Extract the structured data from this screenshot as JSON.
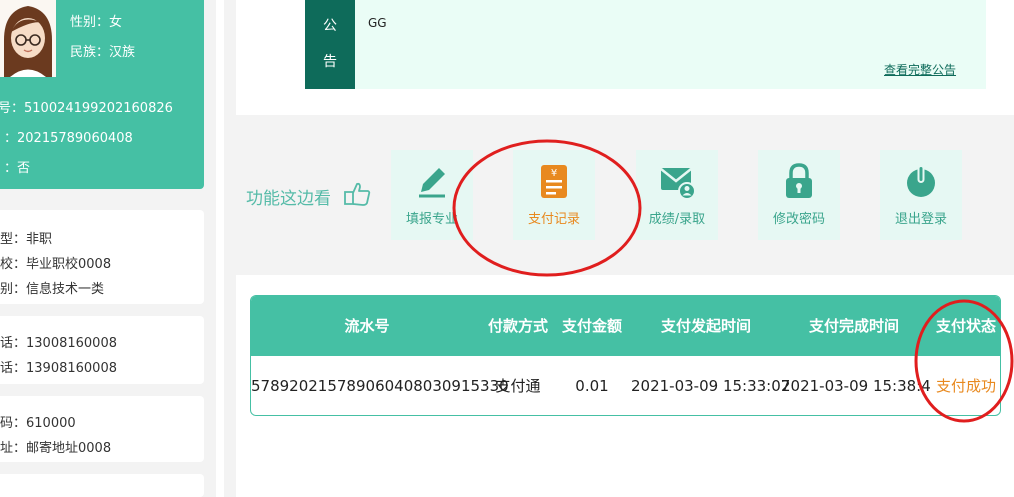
{
  "profile": {
    "gender": "性别：女",
    "ethnicity": "民族：汉族",
    "id_number": "号：510024199202160826",
    "exam_number": "：20215789060408",
    "flag": "：否"
  },
  "education": {
    "type": "型：非职",
    "school": "校：毕业职校0008",
    "category": "别：信息技术一类"
  },
  "contact": {
    "phone1": "话：13008160008",
    "phone2": "话：13908160008"
  },
  "address": {
    "postcode": "码：610000",
    "mail_address": "址：邮寄地址0008"
  },
  "notice": {
    "tag": [
      "公",
      "告"
    ],
    "text": "GG",
    "link": "查看完整公告"
  },
  "functions": {
    "title": "功能这边看",
    "tiles": [
      {
        "label": "填报专业",
        "icon": "pencil-icon"
      },
      {
        "label": "支付记录",
        "icon": "payment-record-icon"
      },
      {
        "label": "成绩/录取",
        "icon": "mail-user-icon"
      },
      {
        "label": "修改密码",
        "icon": "lock-icon"
      },
      {
        "label": "退出登录",
        "icon": "power-icon"
      }
    ]
  },
  "payment_table": {
    "headers": [
      "流水号",
      "付款方式",
      "支付金额",
      "支付发起时间",
      "支付完成时间",
      "支付状态"
    ],
    "rows": [
      {
        "serial": "578920215789060408030915330",
        "method": "支付通",
        "amount": "0.01",
        "start_time": "2021-03-09 15:33:07",
        "finish_time": "2021-03-09 15:38:4",
        "status": "支付成功"
      }
    ]
  },
  "colors": {
    "primary": "#45c0a4",
    "dark_green": "#0e6b5a",
    "accent_orange": "#e8891f",
    "annotation_red": "#e01e1e"
  }
}
